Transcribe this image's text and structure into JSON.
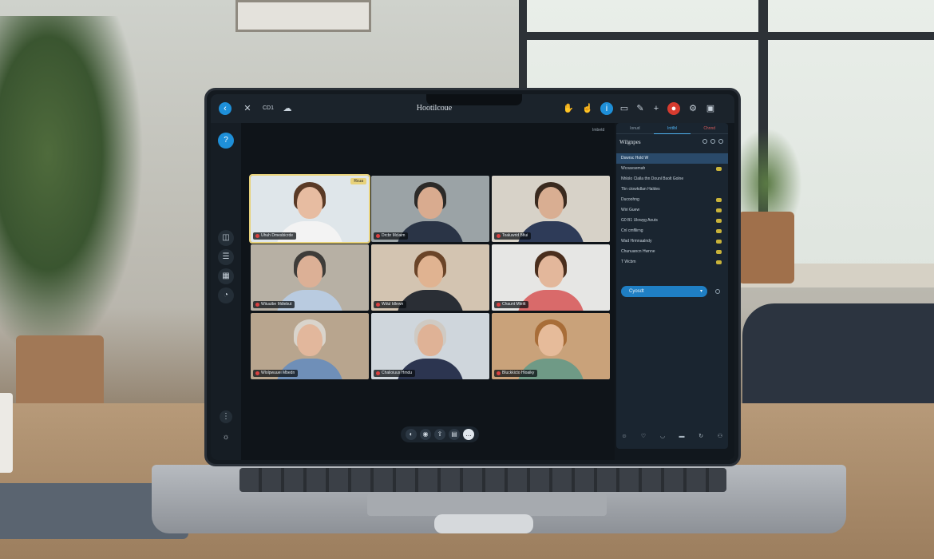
{
  "app": {
    "title": "Hootilcoue"
  },
  "topbar": {
    "left_icons": [
      "back-icon",
      "close-icon",
      "recording-icon",
      "cloud-icon"
    ],
    "recording_label": "CD1",
    "right_icons": [
      "hand-icon",
      "raise-hand-icon",
      "info-icon",
      "chat-icon",
      "edit-icon",
      "add-icon",
      "leave-icon",
      "settings-icon",
      "screen-share-icon"
    ]
  },
  "stage": {
    "tag": "Imbetd"
  },
  "tiles": [
    {
      "name": "Uhuh Dmesbicrde",
      "badge": "Rcua",
      "speaking": true,
      "wall": "#dfe6ea",
      "skin": "#e7bca1",
      "hair": "#5a3a26",
      "shirt": "#f3f3f3"
    },
    {
      "name": "Drcbr Mclaim",
      "badge": "",
      "speaking": false,
      "wall": "#9ba3a6",
      "skin": "#d9ab8f",
      "hair": "#2c2a28",
      "shirt": "#2a3446"
    },
    {
      "name": "Toaluwrid Bfiui",
      "badge": "",
      "speaking": false,
      "wall": "#d7d2c8",
      "skin": "#d9ae92",
      "hair": "#3a2a1f",
      "shirt": "#2e3b58"
    },
    {
      "name": "Wiiuuibe Mdiebut",
      "badge": "",
      "speaking": false,
      "wall": "#b7b0a4",
      "skin": "#dcb096",
      "hair": "#3e3c39",
      "shirt": "#b9cbe0"
    },
    {
      "name": "Wdul Idlewn",
      "badge": "",
      "speaking": false,
      "wall": "#d3c4b1",
      "skin": "#e0b391",
      "hair": "#6a4428",
      "shirt": "#2a2e35"
    },
    {
      "name": "Chaunt Mleitt",
      "badge": "",
      "speaking": false,
      "wall": "#e6e6e4",
      "skin": "#e3b79b",
      "hair": "#4a2e1d",
      "shirt": "#d96a6a"
    },
    {
      "name": "Wlolpwuuei Mbedn",
      "badge": "",
      "speaking": false,
      "wall": "#b8a58e",
      "skin": "#e2b79c",
      "hair": "#d9d4cc",
      "shirt": "#6f8fb8"
    },
    {
      "name": "Chalioiuus Hmdu",
      "badge": "",
      "speaking": false,
      "wall": "#cfd6dc",
      "skin": "#dfb296",
      "hair": "#cfcac3",
      "shirt": "#2c3550"
    },
    {
      "name": "Bluckkicto Hloaiky",
      "badge": "",
      "speaking": false,
      "wall": "#c9a27a",
      "skin": "#e6bb9a",
      "hair": "#a86d38",
      "shirt": "#6f9a86"
    }
  ],
  "controls": [
    "mic-icon",
    "camera-icon",
    "share-icon",
    "chat-icon",
    "more-icon"
  ],
  "rail": {
    "top_icon": "help-icon",
    "icons": [
      "people-icon",
      "notes-icon",
      "calendar-icon",
      "timer-icon"
    ],
    "bottom_icons": [
      "collapse-icon",
      "brightness-icon"
    ]
  },
  "panel": {
    "tabs": [
      {
        "label": "Ionud",
        "state": "normal"
      },
      {
        "label": "Inttlbl",
        "state": "active"
      },
      {
        "label": "Chnnd",
        "state": "alert"
      }
    ],
    "title": "Wilgnpes",
    "participants": [
      {
        "label": "Dswrsc Hold W",
        "selected": true,
        "flag": false
      },
      {
        "label": "Wcoavsemah",
        "selected": false,
        "flag": true
      },
      {
        "label": "Nhlolo Clalla thn Dounl Bsolt Golne",
        "selected": false,
        "flag": false
      },
      {
        "label": "Tlin ctowkdlan Haldes",
        "selected": false,
        "flag": false
      },
      {
        "label": "Ducoohng",
        "selected": false,
        "flag": true
      },
      {
        "label": "Wiri Guew",
        "selected": false,
        "flag": true
      },
      {
        "label": "G0 B1 Ulowyg Aouts",
        "selected": false,
        "flag": true
      },
      {
        "label": "Cnl cmfllirng",
        "selected": false,
        "flag": true
      },
      {
        "label": "Wad Hrmnaalndy",
        "selected": false,
        "flag": true
      },
      {
        "label": "Chunuancn Hwnne",
        "selected": false,
        "flag": true
      },
      {
        "label": "T Wcbm",
        "selected": false,
        "flag": true
      }
    ],
    "input_label": "Cyosdt",
    "bottom_icons": [
      "emoji-icon",
      "reaction-icon",
      "ghost-icon",
      "keyboard-icon",
      "refresh-icon",
      "users-icon"
    ]
  }
}
